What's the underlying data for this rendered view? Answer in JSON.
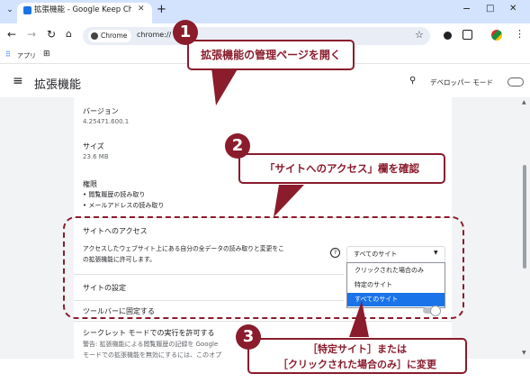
{
  "browser": {
    "tab_title": "拡張機能 - Google Keep Chrome",
    "new_tab": "+",
    "url_chip": "Chrome",
    "url_text": "chrome://",
    "bookmark_apps": "アプリ",
    "window_controls": [
      "−",
      "□",
      "✕"
    ]
  },
  "extensions_page": {
    "title": "拡張機能",
    "dev_mode_label": "デベロッパー モード"
  },
  "details": {
    "version_label": "バージョン",
    "version_value": "4.25471.600.1",
    "size_label": "サイズ",
    "size_value": "23.6 MB",
    "permissions_label": "権限",
    "permissions": [
      "閲覧履歴の読み取り",
      "メールアドレスの読み取り"
    ],
    "site_access_label": "サイトへのアクセス",
    "site_access_desc_line1": "アクセスしたウェブサイト上にある自分の全データの読み取りと変更をこ",
    "site_access_desc_line2": "の拡張機能に許可します。",
    "site_access_help": "?",
    "selected_option": "すべてのサイト",
    "options": [
      "クリックされた場合のみ",
      "特定のサイト",
      "すべてのサイト"
    ],
    "site_settings_label": "サイトの設定",
    "pin_toolbar_label": "ツールバーに固定する",
    "incognito_label": "シークレット モードでの実行を許可する",
    "incognito_desc_line1": "警告: 拡張機能による閲覧履歴の記録を Google",
    "incognito_desc_line2": "モードでの拡張機能を無効にするには、このオプ"
  },
  "callouts": {
    "c1_number": "1",
    "c1_text": "拡張機能の管理ページを開く",
    "c2_number": "2",
    "c2_text": "「サイトへのアクセス」欄を確認",
    "c3_number": "3",
    "c3_line1": "［特定サイト］または",
    "c3_line2": "［クリックされた場合のみ］に変更"
  },
  "colors": {
    "accent": "#8a1c2c",
    "selected_bg": "#1a73e8",
    "tabstrip": "#d3e3fd"
  }
}
